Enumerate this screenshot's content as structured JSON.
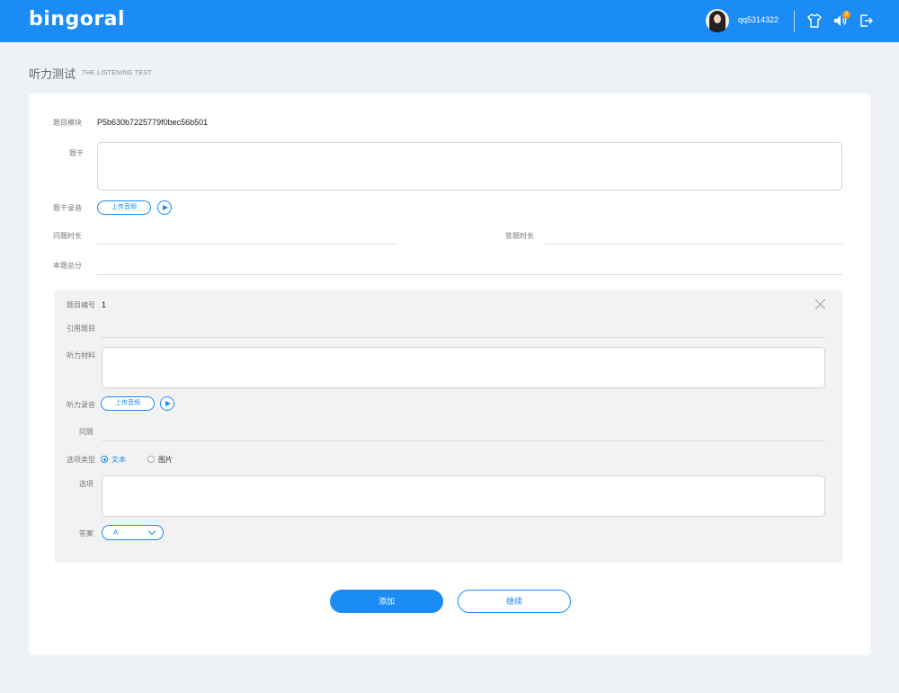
{
  "header": {
    "logo": "bingoral",
    "username": "qq5314322",
    "notification_count": "3",
    "icons": [
      "user-avatar",
      "shirt-icon",
      "speaker-icon",
      "logout-icon"
    ]
  },
  "page": {
    "title": "听力测试",
    "subtitle": "THE LISTENING TEST"
  },
  "form": {
    "module_label": "题目模块",
    "module_value": "P5b630b7225779f0bec56b501",
    "stem_label": "题干",
    "stem_value": "",
    "stem_audio_label": "题干录音",
    "upload_label": "上传音频",
    "question_duration_label": "问题时长",
    "question_duration_value": "",
    "answer_duration_label": "答题时长",
    "answer_duration_value": "",
    "total_score_label": "本题总分",
    "total_score_value": ""
  },
  "subquestion": {
    "number_label": "题目编号",
    "number_value": "1",
    "reference_label": "引用题目",
    "material_label": "听力材料",
    "audio_label": "听力录音",
    "upload_label": "上传音频",
    "question_label": "问题",
    "option_type_label": "选项类型",
    "option_type_choices": [
      "文本",
      "图片"
    ],
    "option_type_selected": "文本",
    "options_label": "选项",
    "answer_label": "答案",
    "answer_value": "A"
  },
  "actions": {
    "add_label": "添加",
    "continue_label": "继续"
  },
  "colors": {
    "primary": "#1b8bf5",
    "badge": "#f39c12",
    "page_bg": "#eef1f5",
    "panel_bg": "#f2f2f2"
  }
}
